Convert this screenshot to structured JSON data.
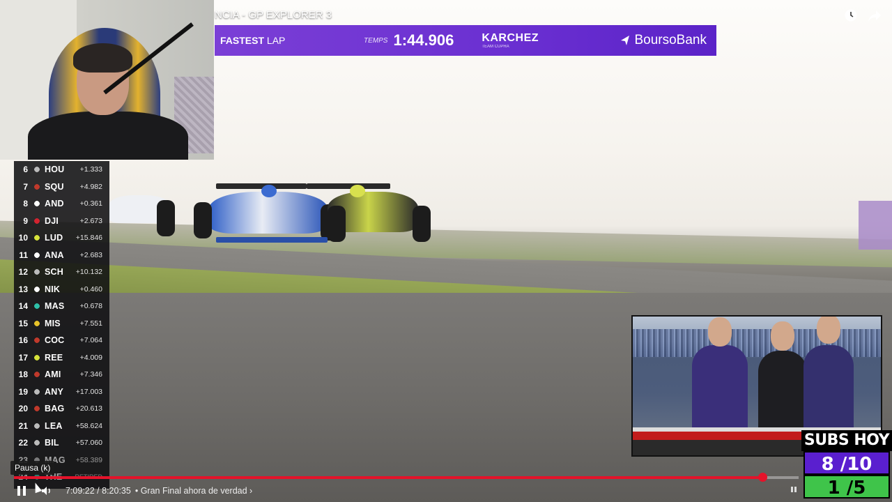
{
  "video": {
    "title": "NCIA - GP EXPLORER 3",
    "watch_later_icon": "clock-icon",
    "share_icon": "share-arrow-icon"
  },
  "banner": {
    "label_bold": "FASTEST",
    "label_light": "LAP",
    "temps_label": "TEMPS",
    "time": "1:44.906",
    "driver": "KARCHEZ",
    "team": "TEAM CUPRA",
    "sponsor": "BoursoBank",
    "color": "#6a2fd1"
  },
  "standings": [
    {
      "pos": "6",
      "code": "HOU",
      "gap": "+1.333",
      "team_color": "#bbbbbb"
    },
    {
      "pos": "7",
      "code": "SQU",
      "gap": "+4.982",
      "team_color": "#c0392b"
    },
    {
      "pos": "8",
      "code": "AND",
      "gap": "+0.361",
      "team_color": "#ffffff"
    },
    {
      "pos": "9",
      "code": "DJI",
      "gap": "+2.673",
      "team_color": "#d3232f"
    },
    {
      "pos": "10",
      "code": "LUD",
      "gap": "+15.846",
      "team_color": "#d6e33a"
    },
    {
      "pos": "11",
      "code": "ANA",
      "gap": "+2.683",
      "team_color": "#ffffff"
    },
    {
      "pos": "12",
      "code": "SCH",
      "gap": "+10.132",
      "team_color": "#bbbbbb"
    },
    {
      "pos": "13",
      "code": "NIK",
      "gap": "+0.460",
      "team_color": "#ffffff"
    },
    {
      "pos": "14",
      "code": "MAS",
      "gap": "+0.678",
      "team_color": "#2ec0a8"
    },
    {
      "pos": "15",
      "code": "MIS",
      "gap": "+7.551",
      "team_color": "#e6c229"
    },
    {
      "pos": "16",
      "code": "COC",
      "gap": "+7.064",
      "team_color": "#c0392b"
    },
    {
      "pos": "17",
      "code": "REE",
      "gap": "+4.009",
      "team_color": "#d6e33a"
    },
    {
      "pos": "18",
      "code": "AMI",
      "gap": "+7.346",
      "team_color": "#c0392b"
    },
    {
      "pos": "19",
      "code": "ANY",
      "gap": "+17.003",
      "team_color": "#bbbbbb"
    },
    {
      "pos": "20",
      "code": "BAG",
      "gap": "+20.613",
      "team_color": "#c0392b"
    },
    {
      "pos": "21",
      "code": "LEA",
      "gap": "+58.624",
      "team_color": "#bbbbbb"
    },
    {
      "pos": "22",
      "code": "BIL",
      "gap": "+57.060",
      "team_color": "#bbbbbb"
    },
    {
      "pos": "23",
      "code": "MAG",
      "gap": "+58.389",
      "team_color": "#bbbbbb"
    },
    {
      "pos": "24",
      "code": "THE",
      "gap": "RETIRED",
      "team_color": "#2ec0a8"
    }
  ],
  "player": {
    "tooltip": "Pausa (k)",
    "time_display": "7:09:22 / 8:20:35",
    "chapter": "• Gran Final ahora de verdad ›",
    "progress": 0.9538,
    "progress_color": "#e4132a",
    "pause_icon": "pause-icon",
    "volume_icon": "volume-icon"
  },
  "subs_widget": {
    "title": "SUBS HOY",
    "goal": "8 /10",
    "bits": "1 /5",
    "goal_color": "#5a1fcf",
    "bits_color": "#3fc44a"
  }
}
